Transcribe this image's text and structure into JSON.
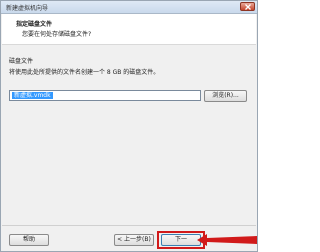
{
  "window": {
    "title": "新建虚拟机向导"
  },
  "header": {
    "title": "指定磁盘文件",
    "subtitle": "您要在何处存储磁盘文件?"
  },
  "disk_section": {
    "label": "磁盘文件",
    "description": "将使用此处所提供的文件名创建一个 8 GB 的磁盘文件。",
    "file_value": "新虚拟.vmdk"
  },
  "buttons": {
    "browse": "浏览(R)...",
    "help": "帮助",
    "back": "< 上一步(B)",
    "next": "下一"
  },
  "colors": {
    "highlight": "#d11a1a",
    "selection": "#3399ff"
  }
}
